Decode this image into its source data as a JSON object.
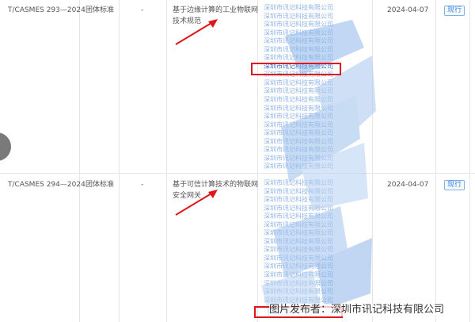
{
  "standards": [
    {
      "code": "T/CASMES 293—2024",
      "type": "团体标准",
      "adopted": "-",
      "name": "基于边缘计算的工业物联网技术规范",
      "date": "2024-04-07",
      "status": "现行",
      "companies": [
        "深圳市讯记科技有限公司",
        "深圳市讯记科技有限公司",
        "深圳市讯记科技有限公司",
        "深圳市讯记科技有限公司",
        "深圳市讯记科技有限公司",
        "深圳市讯记科技有限公司",
        "深圳市讯记科技有限公司",
        "深圳市讯记科技有限公司",
        "深圳市讯记科技有限公司",
        "深圳市讯记科技有限公司",
        "深圳市讯记科技有限公司",
        "深圳市讯记科技有限公司",
        "深圳市讯记科技有限公司",
        "深圳市讯记科技有限公司",
        "深圳市讯记科技有限公司",
        "深圳市讯记科技有限公司",
        "深圳市讯记科技有限公司",
        "深圳市讯记科技有限公司",
        "深圳市讯记科技有限公司",
        "深圳市讯记科技有限公司"
      ]
    },
    {
      "code": "T/CASMES 294—2024",
      "type": "团体标准",
      "adopted": "-",
      "name": "基于可信计算技术的物联网安全网关",
      "date": "2024-04-07",
      "status": "现行",
      "companies": [
        "深圳市讯记科技有限公司",
        "深圳市讯记科技有限公司",
        "深圳市讯记科技有限公司",
        "深圳市讯记科技有限公司",
        "深圳市讯记科技有限公司",
        "深圳市讯记科技有限公司",
        "深圳市讯记科技有限公司",
        "深圳市讯记科技有限公司",
        "深圳市讯记科技有限公司",
        "深圳市讯记科技有限公司",
        "深圳市讯记科技有限公司",
        "深圳市讯记科技有限公司",
        "深圳市讯记科技有限公司",
        "深圳市讯记科技有限公司",
        "深圳市讯记科技有限公司"
      ]
    }
  ],
  "caption": "图片发布者：深圳市讯记科技有限公司",
  "colors": {
    "highlight_box": "#e0161b",
    "arrow": "#e0161b",
    "status_text": "#3a86d6",
    "company_text": "#8fb4e6"
  }
}
